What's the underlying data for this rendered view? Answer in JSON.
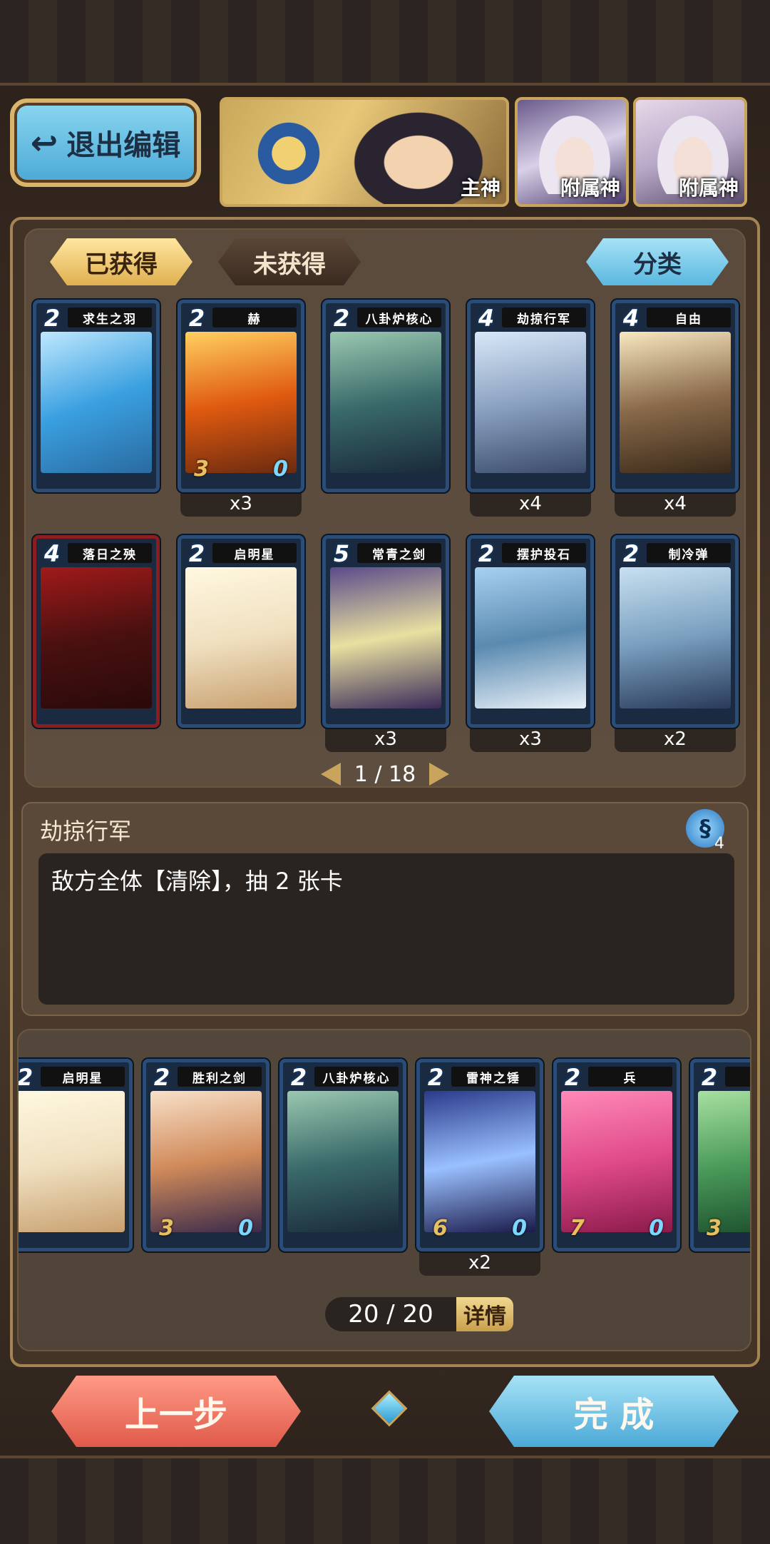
{
  "header": {
    "exit_label": "退出编辑",
    "exit_icon": "return-arrow-icon",
    "gods": [
      {
        "role": "主神"
      },
      {
        "role": "附属神"
      },
      {
        "role": "附属神"
      }
    ]
  },
  "collection": {
    "tabs": [
      "已获得",
      "未获得"
    ],
    "sort_label": "分类",
    "cards": [
      {
        "cost": "2",
        "name": "求生之羽",
        "art": "linear-gradient(160deg,#bfe8ff,#3aa0e0 50%,#2a6aa0)",
        "frame": "blue",
        "count": ""
      },
      {
        "cost": "2",
        "name": "赫",
        "art": "linear-gradient(170deg,#ffd060,#e05a10 50%,#6a2a10)",
        "frame": "blue",
        "count": "x3",
        "atk": "3",
        "hp": "0"
      },
      {
        "cost": "2",
        "name": "八卦炉核心",
        "art": "linear-gradient(170deg,#9ac8b0,#3a6a6a 50%,#1a2a3a)",
        "frame": "blue",
        "count": ""
      },
      {
        "cost": "4",
        "name": "劫掠行军",
        "art": "linear-gradient(170deg,#d8e8f8,#8aa0c0 50%,#3a4a6a)",
        "frame": "blue",
        "count": "x4"
      },
      {
        "cost": "4",
        "name": "自由",
        "art": "linear-gradient(170deg,#f8e8c0,#8a6a4a 50%,#3a2a1a)",
        "frame": "blue",
        "count": "x4"
      },
      {
        "cost": "4",
        "name": "落日之殃",
        "art": "linear-gradient(170deg,#a01a1a,#4a1010 50%,#2a0a0a)",
        "frame": "red",
        "count": ""
      },
      {
        "cost": "2",
        "name": "启明星",
        "art": "linear-gradient(170deg,#fff8e0,#f0e0c0 50%,#c8a070)",
        "frame": "blue",
        "count": ""
      },
      {
        "cost": "5",
        "name": "常青之剑",
        "art": "linear-gradient(170deg,#5a4a8a,#e8e0a0 50%,#3a2a5a)",
        "frame": "blue",
        "count": "x3"
      },
      {
        "cost": "2",
        "name": "摆护投石",
        "art": "linear-gradient(170deg,#a8d0f0,#5a8ab0 50%,#e8f0f8)",
        "frame": "blue",
        "count": "x3"
      },
      {
        "cost": "2",
        "name": "制冷弹",
        "art": "linear-gradient(170deg,#c8e0f0,#7aa0c0 50%,#2a3a5a)",
        "frame": "blue",
        "count": "x2"
      }
    ],
    "page": "1 / 18"
  },
  "detail": {
    "name": "劫掠行军",
    "cost": "4",
    "icon": "sea-serpent-icon",
    "desc": "敌方全体【清除】，抽 2 张卡"
  },
  "deck": {
    "cards": [
      {
        "cost": "2",
        "name": "启明星",
        "art": "linear-gradient(170deg,#fff8e0,#f0e0c0 50%,#c8a070)",
        "count": ""
      },
      {
        "cost": "2",
        "name": "胜利之剑",
        "art": "linear-gradient(170deg,#f8e0c8,#d08a5a 50%,#3a2a4a)",
        "count": "",
        "atk": "3",
        "hp": "0"
      },
      {
        "cost": "2",
        "name": "八卦炉核心",
        "art": "linear-gradient(170deg,#9ac8b0,#3a6a6a 50%,#1a2a3a)",
        "count": ""
      },
      {
        "cost": "2",
        "name": "雷神之锤",
        "art": "linear-gradient(170deg,#2a3a8a,#9ac0ff 50%,#1a1a4a)",
        "count": "x2",
        "atk": "6",
        "hp": "0"
      },
      {
        "cost": "2",
        "name": "兵",
        "art": "linear-gradient(170deg,#ff8ab8,#e04a8a 50%,#8a1a4a)",
        "count": "",
        "atk": "7",
        "hp": "0"
      },
      {
        "cost": "2",
        "name": "",
        "art": "linear-gradient(170deg,#a8e0a0,#4a9a5a 50%,#1a4a2a)",
        "count": "",
        "atk": "3"
      }
    ],
    "total": "20 / 20",
    "details_label": "详情"
  },
  "footer": {
    "prev_label": "上一步",
    "done_label": "完 成"
  }
}
